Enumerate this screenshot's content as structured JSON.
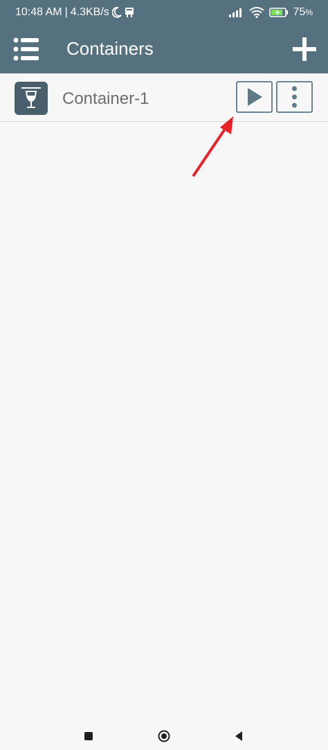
{
  "status_bar": {
    "time": "10:48 AM",
    "separator": "|",
    "network_speed": "4.3KB/s",
    "battery_percent": "75",
    "battery_unit": "%",
    "icons": [
      "moon-icon",
      "notification-icon",
      "signal-icon",
      "wifi-icon",
      "battery-charging-icon"
    ]
  },
  "app_bar": {
    "title": "Containers",
    "menu_icon": "list-menu-icon",
    "add_icon": "plus-icon",
    "background_color": "#55707f"
  },
  "containers": [
    {
      "name": "Container-1",
      "icon": "wine-glass-icon",
      "play_icon": "play-icon",
      "more_icon": "more-vertical-icon"
    }
  ],
  "colors": {
    "accent": "#55707f",
    "annotation_arrow": "#e8222a",
    "button_border": "#6a8492"
  },
  "nav_bar": {
    "icons": [
      "recents-icon",
      "home-icon",
      "back-icon"
    ]
  }
}
